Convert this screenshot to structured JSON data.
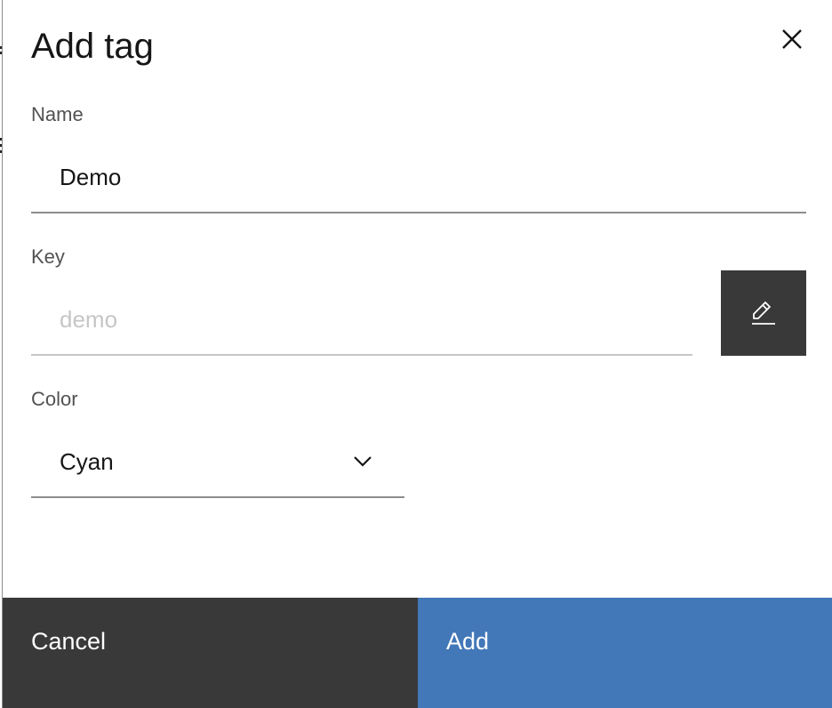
{
  "dialog": {
    "title": "Add tag",
    "close_icon": "close-icon"
  },
  "fields": {
    "name": {
      "label": "Name",
      "value": "Demo"
    },
    "key": {
      "label": "Key",
      "placeholder": "demo",
      "edit_icon": "edit-icon"
    },
    "color": {
      "label": "Color",
      "value": "Cyan",
      "icon": "chevron-down-icon"
    }
  },
  "footer": {
    "cancel_label": "Cancel",
    "add_label": "Add"
  },
  "colors": {
    "primary": "#4277b8",
    "secondary": "#393939"
  }
}
